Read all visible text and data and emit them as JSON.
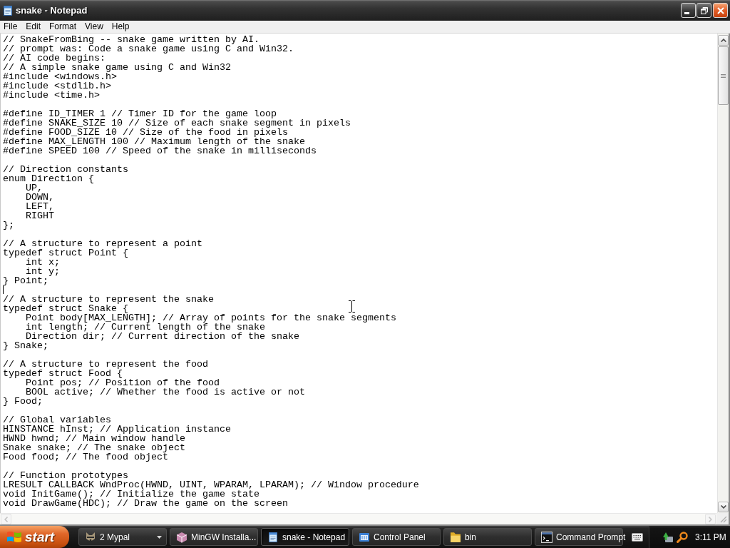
{
  "window": {
    "title": "snake - Notepad",
    "menu": [
      "File",
      "Edit",
      "Format",
      "View",
      "Help"
    ]
  },
  "editor": {
    "blocks": [
      {
        "lines": [
          "// SnakeFromBing -- snake game written by AI.",
          "// prompt was: Code a snake game using C and Win32.",
          "// AI code begins:",
          "// A simple snake game using C and Win32",
          "#include <windows.h>",
          "#include <stdlib.h>",
          "#include <time.h>"
        ],
        "caret_below": false
      },
      {
        "lines": [
          "#define ID_TIMER 1 // Timer ID for the game loop",
          "#define SNAKE_SIZE 10 // Size of each snake segment in pixels",
          "#define FOOD_SIZE 10 // Size of the food in pixels",
          "#define MAX_LENGTH 100 // Maximum length of the snake",
          "#define SPEED 100 // Speed of the snake in milliseconds"
        ],
        "caret_below": false
      },
      {
        "lines": [
          "// Direction constants",
          "enum Direction {",
          "    UP,",
          "    DOWN,",
          "    LEFT,",
          "    RIGHT",
          "};"
        ],
        "caret_below": false
      },
      {
        "lines": [
          "// A structure to represent a point",
          "typedef struct Point {",
          "    int x;",
          "    int y;",
          "} Point;"
        ],
        "caret_below": true
      },
      {
        "lines": [
          "// A structure to represent the snake",
          "typedef struct Snake {",
          "    Point body[MAX_LENGTH]; // Array of points for the snake segments",
          "    int length; // Current length of the snake",
          "    Direction dir; // Current direction of the snake",
          "} Snake;"
        ],
        "caret_below": false
      },
      {
        "lines": [
          "// A structure to represent the food",
          "typedef struct Food {",
          "    Point pos; // Position of the food",
          "    BOOL active; // Whether the food is active or not",
          "} Food;"
        ],
        "caret_below": false
      },
      {
        "lines": [
          "// Global variables",
          "HINSTANCE hInst; // Application instance",
          "HWND hwnd; // Main window handle",
          "Snake snake; // The snake object",
          "Food food; // The food object"
        ],
        "caret_below": false
      },
      {
        "lines": [
          "// Function prototypes",
          "LRESULT CALLBACK WndProc(HWND, UINT, WPARAM, LPARAM); // Window procedure",
          "void InitGame(); // Initialize the game state",
          "void DrawGame(HDC); // Draw the game on the screen"
        ],
        "caret_below": false
      }
    ]
  },
  "taskbar": {
    "start": "start",
    "items": [
      {
        "label": "2 Mypal",
        "grouped": true,
        "selected": false
      },
      {
        "label": "MinGW Installa...",
        "grouped": false,
        "selected": false
      },
      {
        "label": "snake - Notepad",
        "grouped": false,
        "selected": true
      },
      {
        "label": "Control Panel",
        "grouped": false,
        "selected": false
      },
      {
        "label": "bin",
        "grouped": false,
        "selected": false
      },
      {
        "label": "Command Prompt",
        "grouped": false,
        "selected": false
      }
    ],
    "time": "3:11 PM"
  }
}
